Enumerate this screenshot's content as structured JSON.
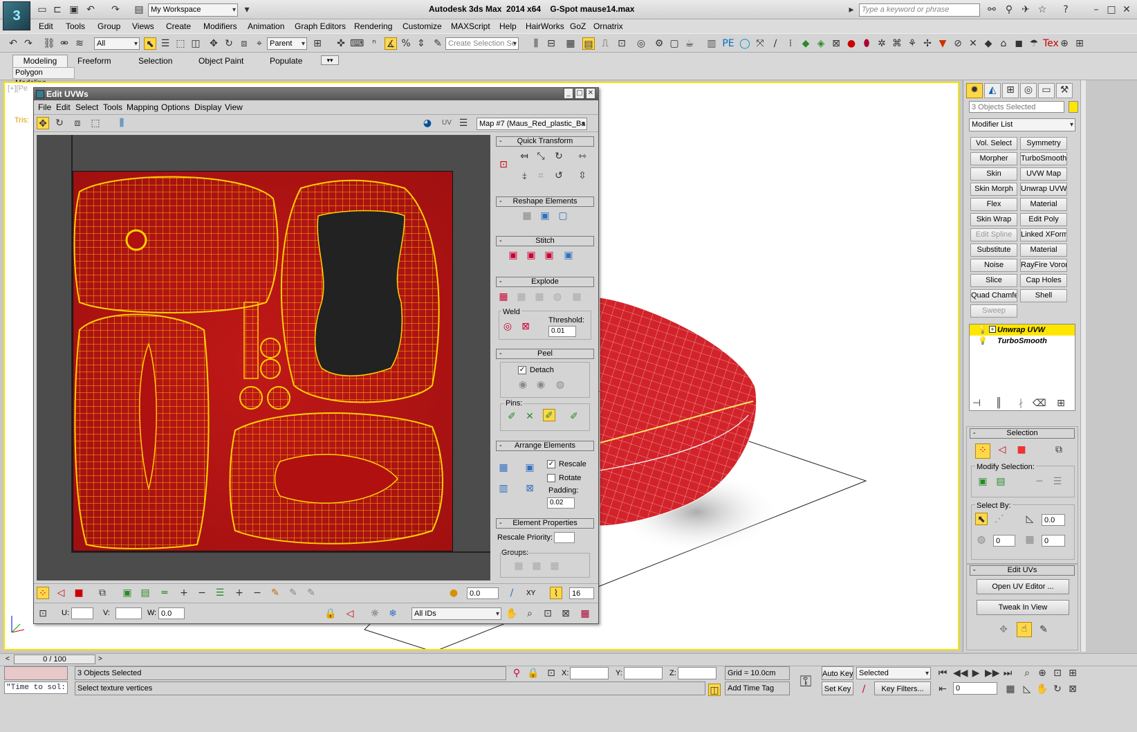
{
  "app": {
    "title": "Autodesk 3ds Max  2014 x64    G-Spot mause14.max",
    "workspace": "My Workspace",
    "search_placeholder": "Type a keyword or phrase"
  },
  "menu": [
    "Edit",
    "Tools",
    "Group",
    "Views",
    "Create",
    "Modifiers",
    "Animation",
    "Graph Editors",
    "Rendering",
    "Customize",
    "MAXScript",
    "Help",
    "HairWorks",
    "GoZ",
    "Ornatrix"
  ],
  "toolbar": {
    "filter": "All",
    "ref_coord": "Parent",
    "selection_set_placeholder": "Create Selection Se"
  },
  "ribbon": {
    "tabs": [
      "Modeling",
      "Freeform",
      "Selection",
      "Object Paint",
      "Populate"
    ],
    "active_tab": "Modeling",
    "subtab": "Polygon Modeling"
  },
  "viewport": {
    "label": "[+][Pe",
    "tris_label": "Tris:"
  },
  "uvw": {
    "title": "Edit UVWs",
    "menu": [
      "File",
      "Edit",
      "Select",
      "Tools",
      "Mapping",
      "Options",
      "Display",
      "View"
    ],
    "uv_label": "UV",
    "map_select": "Map #7 (Maus_Red_plastic_Ba",
    "rollouts": {
      "quick_transform": "Quick Transform",
      "reshape": "Reshape Elements",
      "stitch": "Stitch",
      "explode": "Explode",
      "weld": "Weld",
      "threshold_label": "Threshold:",
      "threshold": "0.01",
      "peel": "Peel",
      "detach": "Detach",
      "pins": "Pins:",
      "arrange": "Arrange Elements",
      "rescale": "Rescale",
      "rotate": "Rotate",
      "padding_label": "Padding:",
      "padding": "0.02",
      "element_props": "Element Properties",
      "rescale_priority": "Rescale Priority:",
      "groups": "Groups:"
    },
    "bottom": {
      "soft_value": "0.0",
      "xy": "XY",
      "grid_value": "16",
      "u_label": "U:",
      "v_label": "V:",
      "w_label": "W:",
      "w_value": "0.0",
      "ids": "All IDs"
    }
  },
  "command_panel": {
    "selection_name": "3 Objects Selected",
    "modifier_list": "Modifier List",
    "modifier_buttons": [
      [
        "Vol. Select",
        "Symmetry"
      ],
      [
        "Morpher",
        "TurboSmooth"
      ],
      [
        "Skin",
        "UVW Map"
      ],
      [
        "Skin Morph",
        "Unwrap UVW"
      ],
      [
        "Flex",
        "Material"
      ],
      [
        "Skin Wrap",
        "Edit Poly"
      ],
      [
        "Edit Spline",
        "Linked XForm"
      ],
      [
        "Substitute",
        "Material"
      ],
      [
        "Noise",
        "RayFire Voronoi"
      ],
      [
        "Slice",
        "Cap Holes"
      ],
      [
        "Quad Chamfer",
        "Shell"
      ],
      [
        "Sweep",
        ""
      ]
    ],
    "stack": [
      "Unwrap UVW",
      "TurboSmooth"
    ],
    "selection_rollout": "Selection",
    "modify_selection": "Modify Selection:",
    "select_by": "Select By:",
    "angle_value": "0.0",
    "spin1": "0",
    "spin2": "0",
    "edit_uvs": "Edit UVs",
    "open_uv_editor": "Open UV Editor ...",
    "tweak_in_view": "Tweak In View"
  },
  "timeline": {
    "frame": "0 / 100"
  },
  "status": {
    "script_text": "\"Time to sol:",
    "objects_selected": "3 Objects Selected",
    "prompt": "Select texture vertices",
    "x_label": "X:",
    "y_label": "Y:",
    "z_label": "Z:",
    "grid": "Grid = 10.0cm",
    "add_time_tag": "Add Time Tag",
    "auto_key": "Auto Key",
    "set_key": "Set Key",
    "key_mode": "Selected",
    "key_filters": "Key Filters...",
    "frame_field": "0"
  }
}
